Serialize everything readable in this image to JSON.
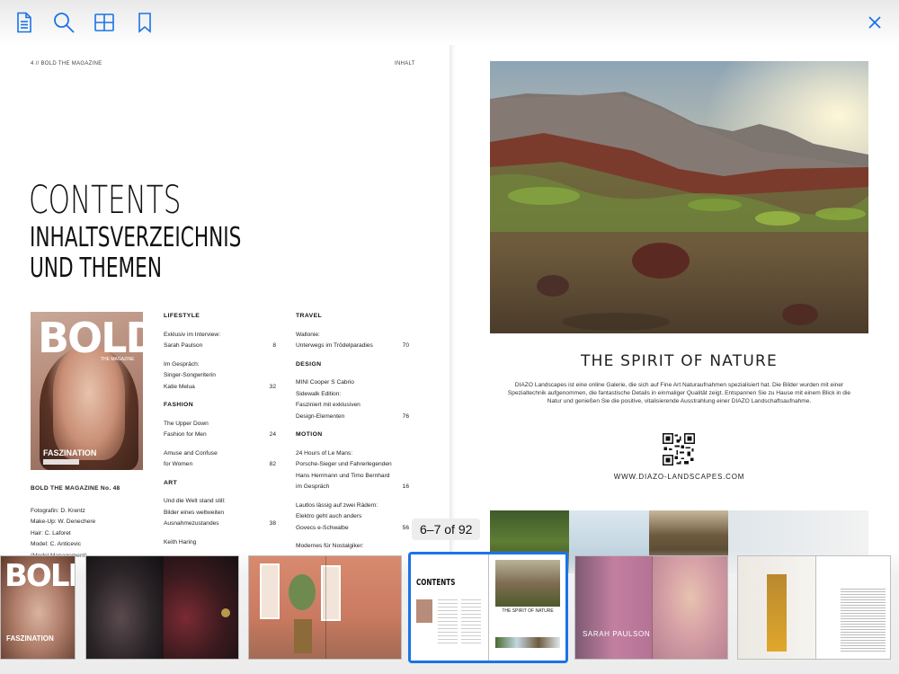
{
  "toolbar": {
    "buttons": [
      {
        "name": "document-icon"
      },
      {
        "name": "search-icon"
      },
      {
        "name": "grid-icon"
      },
      {
        "name": "bookmark-icon"
      }
    ],
    "close": "close-icon",
    "icon_color": "#1a73e8"
  },
  "left_page": {
    "folio": "4  // BOLD THE MAGAZINE",
    "section_tag": "INHALT",
    "title": "CONTENTS",
    "subtitle_line1": "INHALTSVERZEICHNIS",
    "subtitle_line2": "UND THEMEN",
    "cover": {
      "masthead": "BOLD",
      "masthead_sub": "THE MAGAZINE",
      "coverline": "FASZINATION"
    },
    "credits": {
      "heading": "BOLD THE MAGAZINE No. 48",
      "lines": [
        "Fotografin: D. Krentz",
        "Make-Up: W. Denechere",
        "Hair: C. Laforet",
        "Model: C. Anticevic",
        "(Model Management)"
      ]
    },
    "toc_col1": [
      {
        "type": "head",
        "text": "LIFESTYLE"
      },
      {
        "type": "entry",
        "lines": [
          "Exklusiv im Interview:",
          "Sarah Paulson"
        ],
        "page": "8"
      },
      {
        "type": "entry",
        "lines": [
          "Im Gespräch:",
          "Singer-Songwriterin",
          "Katie Melua"
        ],
        "page": "32"
      },
      {
        "type": "head",
        "text": "FASHION"
      },
      {
        "type": "entry",
        "lines": [
          "The Upper Down",
          "Fashion for Men"
        ],
        "page": "24"
      },
      {
        "type": "entry",
        "lines": [
          "Amuse and Confuse",
          "for Women"
        ],
        "page": "82"
      },
      {
        "type": "head",
        "text": "ART"
      },
      {
        "type": "entry",
        "lines": [
          "Und die Welt stand still:",
          "Bilder eines weltweiten",
          "Ausnahmezustandes"
        ],
        "page": "38"
      },
      {
        "type": "entry",
        "lines": [
          "Keith Haring"
        ],
        "page": ""
      }
    ],
    "toc_col2": [
      {
        "type": "head",
        "text": "TRAVEL"
      },
      {
        "type": "entry",
        "lines": [
          "Wallonie:",
          "Unterwegs im Trödelparadies"
        ],
        "page": "70"
      },
      {
        "type": "head",
        "text": "DESIGN"
      },
      {
        "type": "entry",
        "lines": [
          "MINI Cooper S Cabrio",
          "Sidewalk Edition:",
          "Fasziniert mit exklusiven",
          "Design-Elementen"
        ],
        "page": "76"
      },
      {
        "type": "head",
        "text": "MOTION"
      },
      {
        "type": "entry",
        "lines": [
          "24 Hours of Le Mans:",
          "Porsche-Sieger und Fahrerlegenden",
          "Hans Herrmann und Timo Bernhard",
          "im Gespräch"
        ],
        "page": "16"
      },
      {
        "type": "entry",
        "lines": [
          "Lautlos lässig auf zwei Rädern:",
          "Elektro geht auch anders",
          "Govecs e-Schwalbe"
        ],
        "page": "56"
      },
      {
        "type": "entry",
        "lines": [
          "Modernes für Nostalgiker:"
        ],
        "page": ""
      }
    ]
  },
  "right_page": {
    "headline": "THE SPIRIT OF NATURE",
    "body": "DIAZO Landscapes ist eine online Galerie, die sich auf Fine Art Naturaufnahmen spezialisiert hat. Die Bilder wurden mit einer Spezialtechnik aufgenommen, die fantastische Details in einmaliger Qualität zeigt.  Entspannen Sie zu Hause mit einem Blick in die Natur und genießen Sie die positive, vitalisierende Ausstrahlung einer DIAZO Landschaftsaufnahme.",
    "website": "WWW.DIAZO-LANDSCAPES.COM"
  },
  "page_indicator": "6–7 of 92",
  "thumbnails": [
    {
      "name": "thumb-cover",
      "pages": "1"
    },
    {
      "name": "thumb-pages-2-3",
      "pages": "2–3"
    },
    {
      "name": "thumb-pages-4-5",
      "pages": "4–5"
    },
    {
      "name": "thumb-pages-6-7",
      "pages": "6–7",
      "selected": true
    },
    {
      "name": "thumb-pages-8-9",
      "pages": "8–9"
    },
    {
      "name": "thumb-pages-10-11",
      "pages": "10–11"
    }
  ],
  "mini": {
    "contents": "CONTENTS",
    "spirit": "THE SPIRIT OF NATURE",
    "sarah": "SARAH PAULSON",
    "fasz": "FASZINATION"
  }
}
